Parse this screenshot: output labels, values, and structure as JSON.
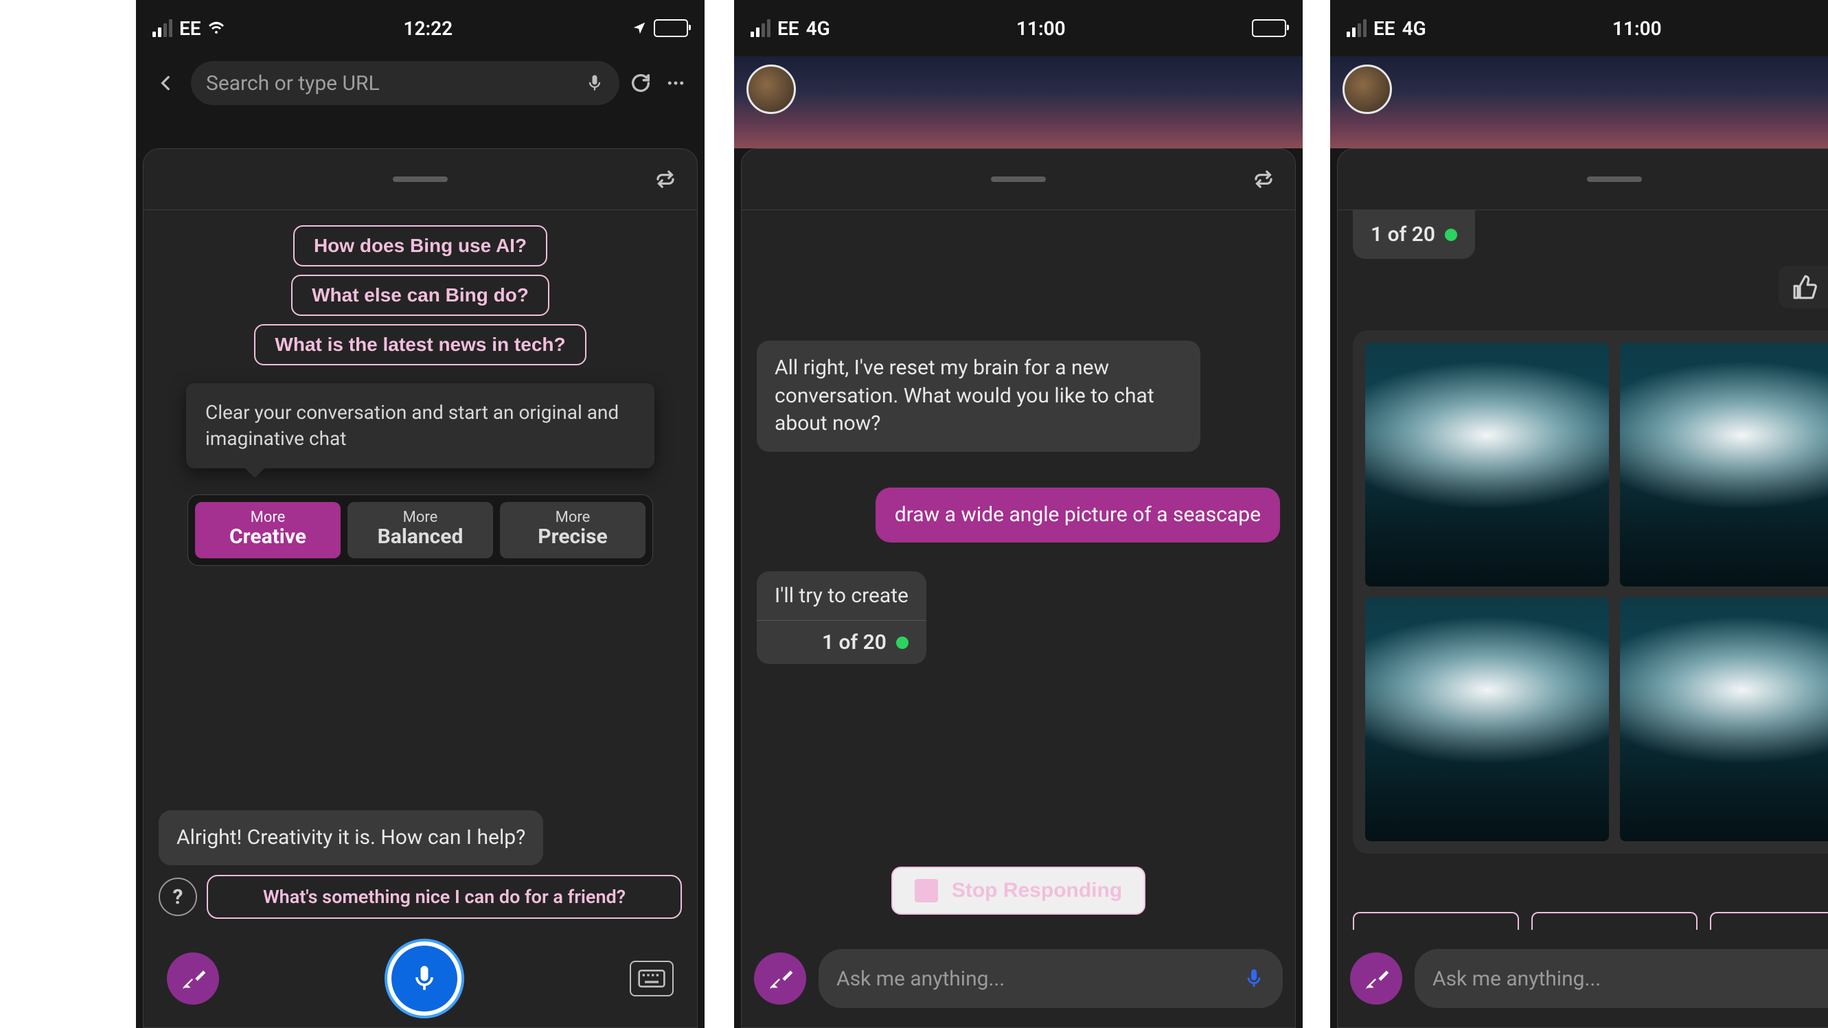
{
  "phone1": {
    "status": {
      "carrier": "EE",
      "time": "12:22"
    },
    "search_placeholder": "Search or type URL",
    "suggestions": [
      "How does Bing use AI?",
      "What else can Bing do?",
      "What is the latest news in tech?"
    ],
    "tooltip": "Clear your conversation and start an original and imaginative chat",
    "modes": {
      "sup": "More",
      "creative": "Creative",
      "balanced": "Balanced",
      "precise": "Precise"
    },
    "bot_reply": "Alright! Creativity it is. How can I help?",
    "bottom_suggestion": "What's something nice I can do for a friend?"
  },
  "phone2": {
    "status": {
      "carrier": "EE",
      "network": "4G",
      "time": "11:00"
    },
    "bot_intro": "All right, I've reset my brain for a new conversation. What would you like to chat about now?",
    "user_msg": "draw a wide angle picture of a seascape",
    "bot_try": "I'll try to create",
    "progress": "1 of 20",
    "stop": "Stop Responding",
    "ask_placeholder": "Ask me anything..."
  },
  "phone3": {
    "status": {
      "carrier": "EE",
      "network": "4G",
      "time": "11:00"
    },
    "progress": "1 of 20",
    "ask_placeholder": "Ask me anything..."
  }
}
